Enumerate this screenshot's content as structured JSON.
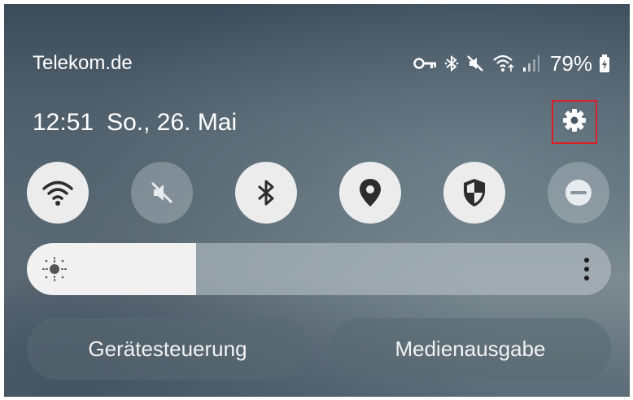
{
  "status_bar": {
    "carrier": "Telekom.de",
    "battery_percent": "79%",
    "icons": [
      "vpn-key-icon",
      "bluetooth-icon",
      "mute-icon",
      "wifi-icon",
      "signal-icon",
      "battery-charging-icon"
    ]
  },
  "header": {
    "time": "12:51",
    "date": "So., 26. Mai",
    "settings_icon": "gear-icon"
  },
  "quick_settings": [
    {
      "name": "wifi",
      "icon": "wifi-icon",
      "active": true
    },
    {
      "name": "sound",
      "icon": "mute-icon",
      "active": false
    },
    {
      "name": "bluetooth",
      "icon": "bluetooth-icon",
      "active": true
    },
    {
      "name": "location",
      "icon": "location-pin-icon",
      "active": true
    },
    {
      "name": "security",
      "icon": "shield-icon",
      "active": true
    },
    {
      "name": "do-not-disturb",
      "icon": "minus-circle-icon",
      "active": false
    }
  ],
  "brightness": {
    "level_fraction": 0.29,
    "icon": "sun-icon",
    "menu_icon": "more-vert-icon"
  },
  "buttons": {
    "device_control": "Gerätesteuerung",
    "media_output": "Medienausgabe"
  },
  "colors": {
    "highlight_border": "#d9202a",
    "tile_active": "#ececec"
  }
}
